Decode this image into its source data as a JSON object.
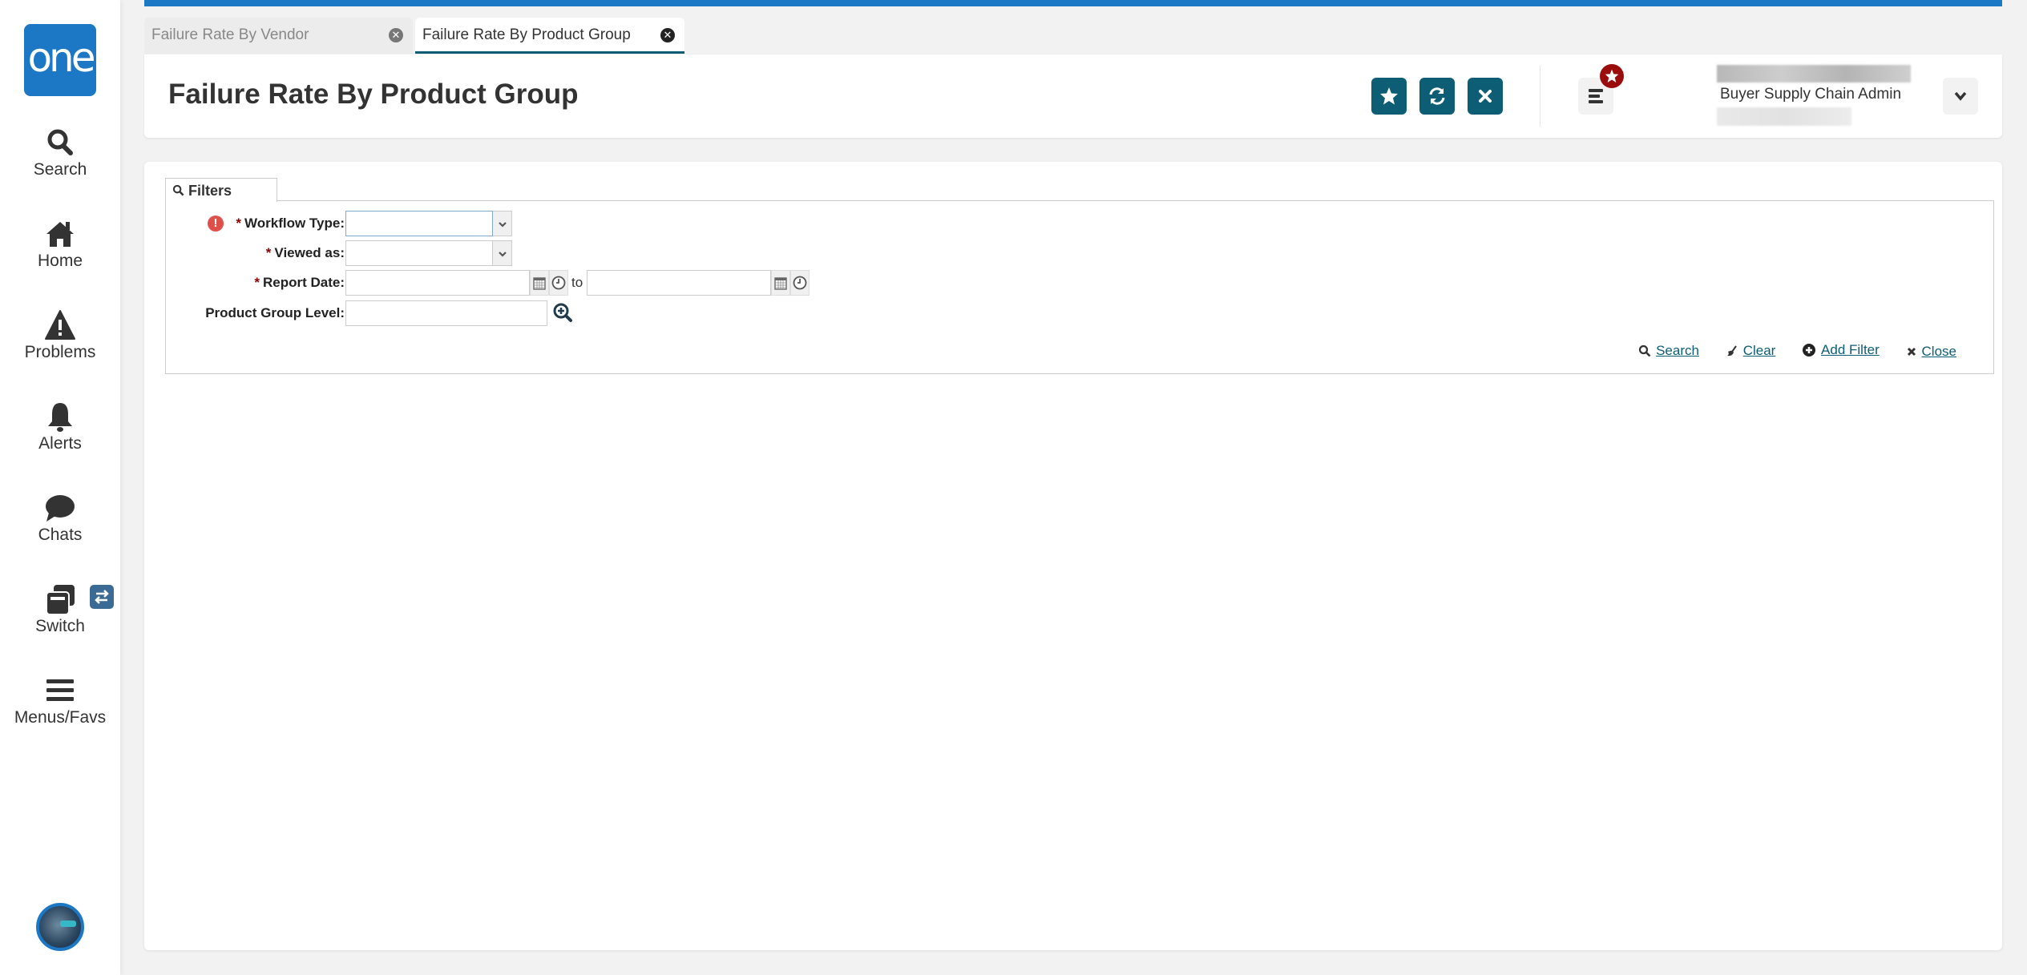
{
  "sidebar": {
    "logo_text": "one",
    "items": [
      {
        "label": "Search",
        "icon": "search-icon"
      },
      {
        "label": "Home",
        "icon": "home-icon"
      },
      {
        "label": "Problems",
        "icon": "warning-icon"
      },
      {
        "label": "Alerts",
        "icon": "bell-icon"
      },
      {
        "label": "Chats",
        "icon": "chat-icon"
      },
      {
        "label": "Switch",
        "icon": "switch-icon"
      },
      {
        "label": "Menus/Favs",
        "icon": "hamburger-icon"
      }
    ],
    "switch_badge_icon": "swap-arrows-icon",
    "avatar_icon": "user-avatar"
  },
  "tabs": [
    {
      "label": "Failure Rate By Vendor",
      "active": false
    },
    {
      "label": "Failure Rate By Product Group",
      "active": true
    }
  ],
  "header": {
    "title": "Failure Rate By Product Group",
    "buttons": [
      "favorite-star-icon",
      "refresh-icon",
      "close-icon"
    ],
    "user_role": "Buyer Supply Chain Admin"
  },
  "filters": {
    "tab_label": "Filters",
    "fields": [
      {
        "label": "Workflow Type:",
        "required": true,
        "type": "select",
        "value": "",
        "error": true
      },
      {
        "label": "Viewed as:",
        "required": true,
        "type": "select",
        "value": ""
      },
      {
        "label": "Report Date:",
        "required": true,
        "type": "date-range",
        "from": "",
        "to": "",
        "range_separator": "to"
      },
      {
        "label": "Product Group Level:",
        "required": false,
        "type": "lookup",
        "value": ""
      }
    ],
    "required_marker": "*",
    "error_marker": "!",
    "actions": [
      {
        "label": "Search",
        "icon": "search-icon"
      },
      {
        "label": "Clear",
        "icon": "broom-icon"
      },
      {
        "label": "Add Filter",
        "icon": "plus-circle-icon"
      },
      {
        "label": "Close",
        "icon": "close-x-icon"
      }
    ]
  },
  "colors": {
    "brand_blue": "#1c78c4",
    "primary_teal": "#0d5d74",
    "badge_red": "#9b0d0d",
    "error_red": "#e0504a"
  }
}
